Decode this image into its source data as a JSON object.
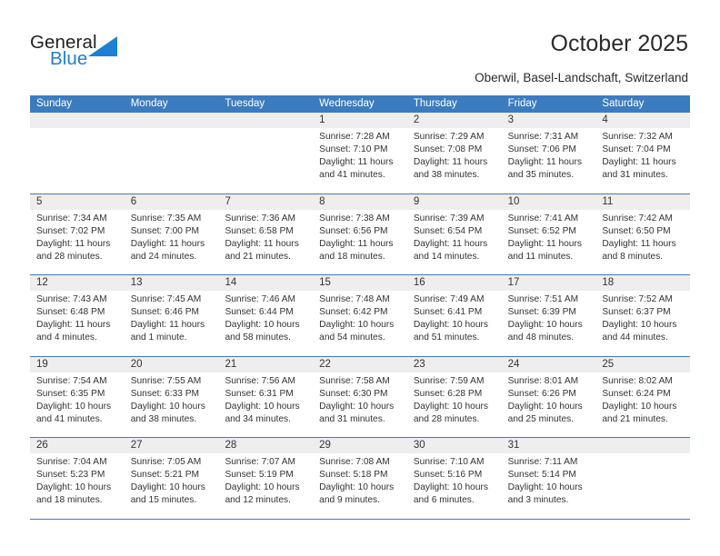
{
  "brand": {
    "name_part1": "General",
    "name_part2": "Blue",
    "triangle_color": "#1f7fd0",
    "accent_color": "#3b7cbf"
  },
  "header": {
    "title": "October 2025",
    "subtitle": "Oberwil, Basel-Landschaft, Switzerland"
  },
  "weekdays": [
    "Sunday",
    "Monday",
    "Tuesday",
    "Wednesday",
    "Thursday",
    "Friday",
    "Saturday"
  ],
  "weeks": [
    [
      {
        "day": "",
        "sunrise": "",
        "sunset": "",
        "daylight_line1": "",
        "daylight_line2": ""
      },
      {
        "day": "",
        "sunrise": "",
        "sunset": "",
        "daylight_line1": "",
        "daylight_line2": ""
      },
      {
        "day": "",
        "sunrise": "",
        "sunset": "",
        "daylight_line1": "",
        "daylight_line2": ""
      },
      {
        "day": "1",
        "sunrise": "Sunrise: 7:28 AM",
        "sunset": "Sunset: 7:10 PM",
        "daylight_line1": "Daylight: 11 hours",
        "daylight_line2": "and 41 minutes."
      },
      {
        "day": "2",
        "sunrise": "Sunrise: 7:29 AM",
        "sunset": "Sunset: 7:08 PM",
        "daylight_line1": "Daylight: 11 hours",
        "daylight_line2": "and 38 minutes."
      },
      {
        "day": "3",
        "sunrise": "Sunrise: 7:31 AM",
        "sunset": "Sunset: 7:06 PM",
        "daylight_line1": "Daylight: 11 hours",
        "daylight_line2": "and 35 minutes."
      },
      {
        "day": "4",
        "sunrise": "Sunrise: 7:32 AM",
        "sunset": "Sunset: 7:04 PM",
        "daylight_line1": "Daylight: 11 hours",
        "daylight_line2": "and 31 minutes."
      }
    ],
    [
      {
        "day": "5",
        "sunrise": "Sunrise: 7:34 AM",
        "sunset": "Sunset: 7:02 PM",
        "daylight_line1": "Daylight: 11 hours",
        "daylight_line2": "and 28 minutes."
      },
      {
        "day": "6",
        "sunrise": "Sunrise: 7:35 AM",
        "sunset": "Sunset: 7:00 PM",
        "daylight_line1": "Daylight: 11 hours",
        "daylight_line2": "and 24 minutes."
      },
      {
        "day": "7",
        "sunrise": "Sunrise: 7:36 AM",
        "sunset": "Sunset: 6:58 PM",
        "daylight_line1": "Daylight: 11 hours",
        "daylight_line2": "and 21 minutes."
      },
      {
        "day": "8",
        "sunrise": "Sunrise: 7:38 AM",
        "sunset": "Sunset: 6:56 PM",
        "daylight_line1": "Daylight: 11 hours",
        "daylight_line2": "and 18 minutes."
      },
      {
        "day": "9",
        "sunrise": "Sunrise: 7:39 AM",
        "sunset": "Sunset: 6:54 PM",
        "daylight_line1": "Daylight: 11 hours",
        "daylight_line2": "and 14 minutes."
      },
      {
        "day": "10",
        "sunrise": "Sunrise: 7:41 AM",
        "sunset": "Sunset: 6:52 PM",
        "daylight_line1": "Daylight: 11 hours",
        "daylight_line2": "and 11 minutes."
      },
      {
        "day": "11",
        "sunrise": "Sunrise: 7:42 AM",
        "sunset": "Sunset: 6:50 PM",
        "daylight_line1": "Daylight: 11 hours",
        "daylight_line2": "and 8 minutes."
      }
    ],
    [
      {
        "day": "12",
        "sunrise": "Sunrise: 7:43 AM",
        "sunset": "Sunset: 6:48 PM",
        "daylight_line1": "Daylight: 11 hours",
        "daylight_line2": "and 4 minutes."
      },
      {
        "day": "13",
        "sunrise": "Sunrise: 7:45 AM",
        "sunset": "Sunset: 6:46 PM",
        "daylight_line1": "Daylight: 11 hours",
        "daylight_line2": "and 1 minute."
      },
      {
        "day": "14",
        "sunrise": "Sunrise: 7:46 AM",
        "sunset": "Sunset: 6:44 PM",
        "daylight_line1": "Daylight: 10 hours",
        "daylight_line2": "and 58 minutes."
      },
      {
        "day": "15",
        "sunrise": "Sunrise: 7:48 AM",
        "sunset": "Sunset: 6:42 PM",
        "daylight_line1": "Daylight: 10 hours",
        "daylight_line2": "and 54 minutes."
      },
      {
        "day": "16",
        "sunrise": "Sunrise: 7:49 AM",
        "sunset": "Sunset: 6:41 PM",
        "daylight_line1": "Daylight: 10 hours",
        "daylight_line2": "and 51 minutes."
      },
      {
        "day": "17",
        "sunrise": "Sunrise: 7:51 AM",
        "sunset": "Sunset: 6:39 PM",
        "daylight_line1": "Daylight: 10 hours",
        "daylight_line2": "and 48 minutes."
      },
      {
        "day": "18",
        "sunrise": "Sunrise: 7:52 AM",
        "sunset": "Sunset: 6:37 PM",
        "daylight_line1": "Daylight: 10 hours",
        "daylight_line2": "and 44 minutes."
      }
    ],
    [
      {
        "day": "19",
        "sunrise": "Sunrise: 7:54 AM",
        "sunset": "Sunset: 6:35 PM",
        "daylight_line1": "Daylight: 10 hours",
        "daylight_line2": "and 41 minutes."
      },
      {
        "day": "20",
        "sunrise": "Sunrise: 7:55 AM",
        "sunset": "Sunset: 6:33 PM",
        "daylight_line1": "Daylight: 10 hours",
        "daylight_line2": "and 38 minutes."
      },
      {
        "day": "21",
        "sunrise": "Sunrise: 7:56 AM",
        "sunset": "Sunset: 6:31 PM",
        "daylight_line1": "Daylight: 10 hours",
        "daylight_line2": "and 34 minutes."
      },
      {
        "day": "22",
        "sunrise": "Sunrise: 7:58 AM",
        "sunset": "Sunset: 6:30 PM",
        "daylight_line1": "Daylight: 10 hours",
        "daylight_line2": "and 31 minutes."
      },
      {
        "day": "23",
        "sunrise": "Sunrise: 7:59 AM",
        "sunset": "Sunset: 6:28 PM",
        "daylight_line1": "Daylight: 10 hours",
        "daylight_line2": "and 28 minutes."
      },
      {
        "day": "24",
        "sunrise": "Sunrise: 8:01 AM",
        "sunset": "Sunset: 6:26 PM",
        "daylight_line1": "Daylight: 10 hours",
        "daylight_line2": "and 25 minutes."
      },
      {
        "day": "25",
        "sunrise": "Sunrise: 8:02 AM",
        "sunset": "Sunset: 6:24 PM",
        "daylight_line1": "Daylight: 10 hours",
        "daylight_line2": "and 21 minutes."
      }
    ],
    [
      {
        "day": "26",
        "sunrise": "Sunrise: 7:04 AM",
        "sunset": "Sunset: 5:23 PM",
        "daylight_line1": "Daylight: 10 hours",
        "daylight_line2": "and 18 minutes."
      },
      {
        "day": "27",
        "sunrise": "Sunrise: 7:05 AM",
        "sunset": "Sunset: 5:21 PM",
        "daylight_line1": "Daylight: 10 hours",
        "daylight_line2": "and 15 minutes."
      },
      {
        "day": "28",
        "sunrise": "Sunrise: 7:07 AM",
        "sunset": "Sunset: 5:19 PM",
        "daylight_line1": "Daylight: 10 hours",
        "daylight_line2": "and 12 minutes."
      },
      {
        "day": "29",
        "sunrise": "Sunrise: 7:08 AM",
        "sunset": "Sunset: 5:18 PM",
        "daylight_line1": "Daylight: 10 hours",
        "daylight_line2": "and 9 minutes."
      },
      {
        "day": "30",
        "sunrise": "Sunrise: 7:10 AM",
        "sunset": "Sunset: 5:16 PM",
        "daylight_line1": "Daylight: 10 hours",
        "daylight_line2": "and 6 minutes."
      },
      {
        "day": "31",
        "sunrise": "Sunrise: 7:11 AM",
        "sunset": "Sunset: 5:14 PM",
        "daylight_line1": "Daylight: 10 hours",
        "daylight_line2": "and 3 minutes."
      },
      {
        "day": "",
        "sunrise": "",
        "sunset": "",
        "daylight_line1": "",
        "daylight_line2": ""
      }
    ]
  ]
}
